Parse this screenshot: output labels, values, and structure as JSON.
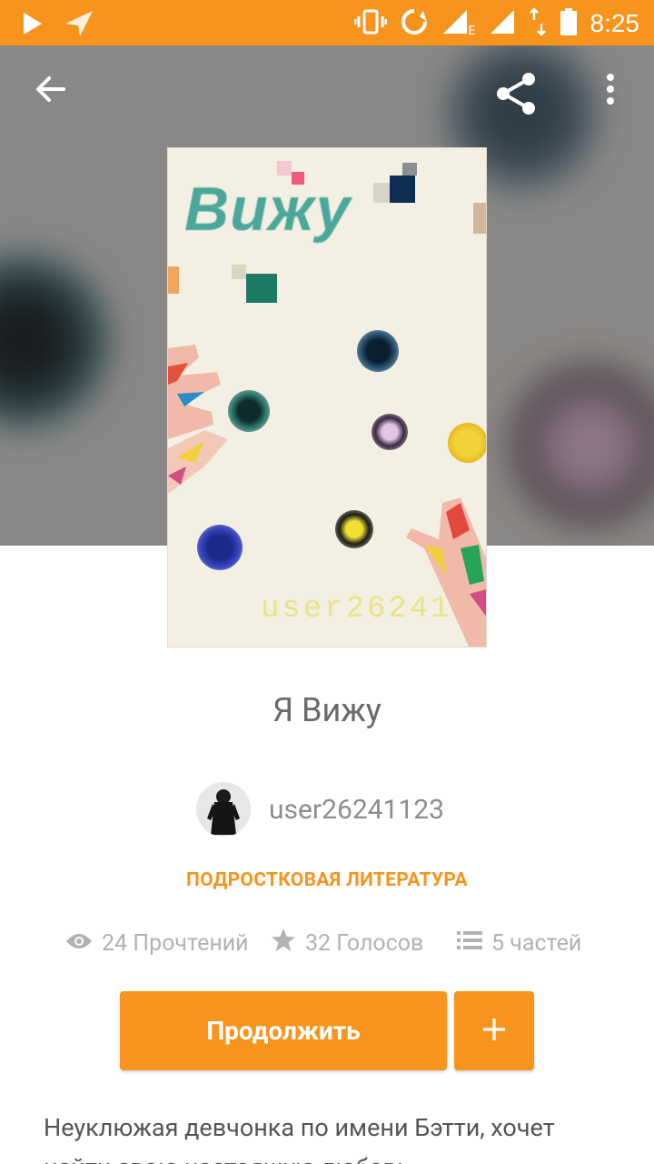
{
  "status_bar": {
    "time": "8:25",
    "network_label": "E",
    "icons": [
      "play-icon",
      "navigation-icon",
      "vibrate-icon",
      "sync-icon",
      "signal-icon",
      "signal-icon",
      "data-arrows-icon",
      "battery-icon"
    ]
  },
  "toolbar": {
    "back_icon": "arrow-back-icon",
    "share_icon": "share-icon",
    "menu_icon": "more-vert-icon"
  },
  "cover": {
    "title_text": "Вижу",
    "signature": "user26241"
  },
  "book": {
    "title": "Я Вижу",
    "author": "user26241123",
    "category": "ПОДРОСТКОВАЯ ЛИТЕРАТУРА",
    "reads": "24 Прочтений",
    "votes": "32 Голосов",
    "parts": "5 частей",
    "description": "Неуклюжая девчонка по имени Бэтти, хочет найти свою настоящую любовь..."
  },
  "actions": {
    "continue_label": "Продолжить",
    "add_label": "+"
  },
  "colors": {
    "accent": "#f7941d",
    "hero_bg": "#8a8886",
    "muted_text": "#b2b2b2"
  }
}
